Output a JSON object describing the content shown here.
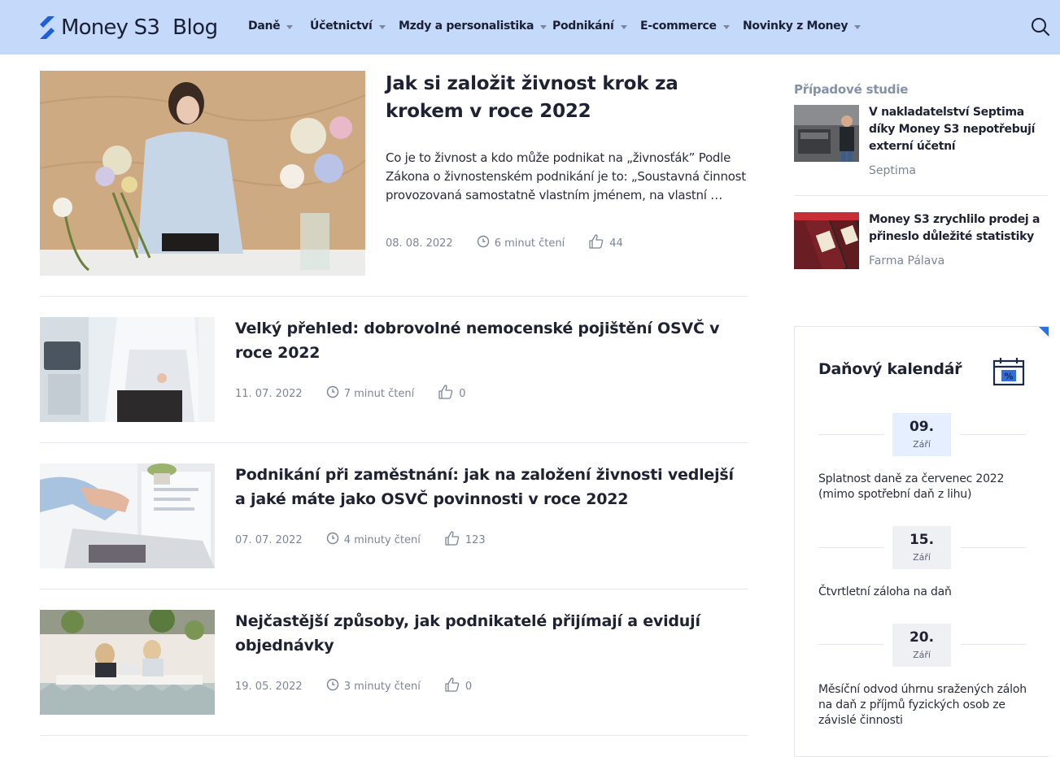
{
  "brand": {
    "name": "Money S3",
    "section": "Blog",
    "accent": "#1d5fd8",
    "header_bg": "#c5d9fb"
  },
  "nav": [
    {
      "label": "Daně"
    },
    {
      "label": "Účetnictví"
    },
    {
      "label": "Mzdy a personalistika"
    },
    {
      "label": "Podnikání"
    },
    {
      "label": "E-commerce"
    },
    {
      "label": "Novinky z Money"
    }
  ],
  "search": {
    "icon": "search-icon"
  },
  "featured": {
    "title": "Jak si založit živnost krok za krokem v roce 2022",
    "excerpt": "Co je to živnost a kdo může podnikat na „živnosťák” Podle Zákona o živnostenském podnikání je to: „Soustavná činnost provozovaná samostatně vlastním jménem, na vlastní …",
    "date": "08. 08. 2022",
    "read_time": "6 minut čtení",
    "likes": "44"
  },
  "articles": [
    {
      "title": "Velký přehled: dobrovolné nemocenské pojištění OSVČ v roce 2022",
      "date": "11. 07. 2022",
      "read_time": "7 minut čtení",
      "likes": "0"
    },
    {
      "title": "Podnikání při zaměstnání: jak na založení živnosti vedlejší a jaké máte jako OSVČ povinnosti v roce 2022",
      "date": "07. 07. 2022",
      "read_time": "4 minuty čtení",
      "likes": "123"
    },
    {
      "title": "Nejčastější způsoby, jak podnikatelé přijímají a evidují objednávky",
      "date": "19. 05. 2022",
      "read_time": "3 minuty čtení",
      "likes": "0"
    }
  ],
  "sidebar": {
    "case_studies_heading": "Případové studie",
    "case_studies": [
      {
        "title": "V nakladatelství Septima díky Money S3 nepotřebují externí účetní",
        "company": "Septima"
      },
      {
        "title": "Money S3 zrychlilo prodej a přineslo důležité statistiky",
        "company": "Farma Pálava"
      }
    ],
    "tax_calendar": {
      "title": "Daňový kalendář",
      "dates": [
        {
          "day": "09.",
          "month": "Září",
          "description": "Splatnost daně za červenec 2022 (mimo spotřební daň z lihu)"
        },
        {
          "day": "15.",
          "month": "Září",
          "description": "Čtvrtletní záloha na daň"
        },
        {
          "day": "20.",
          "month": "Září",
          "description": "Měsíční odvod úhrnu sražených záloh na daň z příjmů fyzických osob ze závislé činnosti"
        }
      ]
    }
  }
}
